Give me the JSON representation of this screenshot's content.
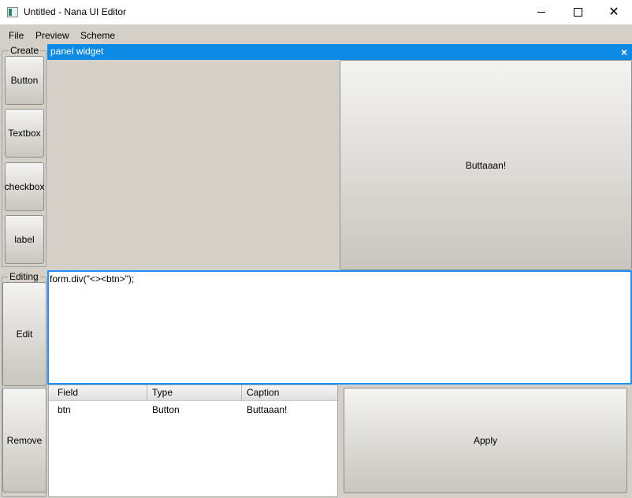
{
  "window": {
    "title": "Untitled - Nana UI Editor",
    "controls": {
      "minimize": "—",
      "maximize": "☐",
      "close": "✕"
    }
  },
  "menu": {
    "items": [
      "File",
      "Preview",
      "Scheme"
    ]
  },
  "create_group": {
    "label": "Create",
    "buttons": [
      "Button",
      "Textbox",
      "checkbox",
      "label"
    ]
  },
  "editing_group": {
    "label": "Editing",
    "buttons": [
      "Edit",
      "Remove"
    ]
  },
  "panel": {
    "title": "panel widget",
    "close_symbol": "×",
    "preview_button_label": "Buttaaan!"
  },
  "code_editor": {
    "text": "form.div(\"<><btn>\");"
  },
  "properties_table": {
    "columns": [
      "Field",
      "Type",
      "Caption"
    ],
    "rows": [
      [
        "btn",
        "Button",
        "Buttaaan!"
      ]
    ]
  },
  "apply_button": {
    "label": "Apply"
  },
  "colors": {
    "panel_header": "#0c8ae5",
    "focus_border": "#1e90ff",
    "window_background": "#d4d0c8"
  }
}
